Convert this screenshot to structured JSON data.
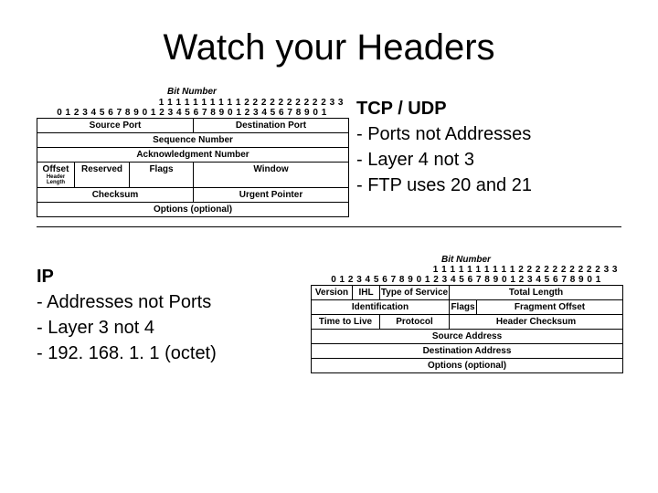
{
  "title": "Watch your Headers",
  "tcp_block": {
    "heading": "TCP / UDP",
    "points": [
      "- Ports not Addresses",
      "- Layer 4 not 3",
      "- FTP uses 20 and 21"
    ]
  },
  "ip_block": {
    "heading": "IP",
    "points": [
      "- Addresses not Ports",
      "- Layer 3 not 4",
      "- 192. 168. 1. 1 (octet)"
    ]
  },
  "bit_header_label": "Bit Number",
  "bit_numbers_row1": "1 1 1 1 1 1 1 1 1 1 2 2 2 2 2 2 2 2 2 2 3 3",
  "bit_numbers_row2": "0 1 2 3 4 5 6 7 8 9 0 1 2 3 4 5 6 7 8 9 0 1 2 3 4 5 6 7 8 9 0 1",
  "tcp_header": {
    "source_port": "Source Port",
    "destination_port": "Destination Port",
    "sequence_number": "Sequence Number",
    "ack_number": "Acknowledgment Number",
    "offset": "Offset",
    "offset_sub": "Header Length",
    "reserved": "Reserved",
    "flags": "Flags",
    "window": "Window",
    "checksum": "Checksum",
    "urgent_pointer": "Urgent Pointer",
    "options": "Options (optional)"
  },
  "ip_header": {
    "version": "Version",
    "ihl": "IHL",
    "tos": "Type of Service",
    "total_length": "Total Length",
    "identification": "Identification",
    "flags": "Flags",
    "fragment_offset": "Fragment Offset",
    "ttl": "Time to Live",
    "protocol": "Protocol",
    "header_checksum": "Header Checksum",
    "source_address": "Source Address",
    "destination_address": "Destination Address",
    "options": "Options (optional)"
  },
  "chart_data": [
    {
      "type": "table",
      "title": "TCP Header Format",
      "bit_width": 32,
      "rows": [
        [
          {
            "field": "Source Port",
            "bits": "0-15"
          },
          {
            "field": "Destination Port",
            "bits": "16-31"
          }
        ],
        [
          {
            "field": "Sequence Number",
            "bits": "0-31"
          }
        ],
        [
          {
            "field": "Acknowledgment Number",
            "bits": "0-31"
          }
        ],
        [
          {
            "field": "Offset (Header Length)",
            "bits": "0-3"
          },
          {
            "field": "Reserved",
            "bits": "4-9"
          },
          {
            "field": "Flags",
            "bits": "10-15"
          },
          {
            "field": "Window",
            "bits": "16-31"
          }
        ],
        [
          {
            "field": "Checksum",
            "bits": "0-15"
          },
          {
            "field": "Urgent Pointer",
            "bits": "16-31"
          }
        ],
        [
          {
            "field": "Options (optional)",
            "bits": "0-31"
          }
        ]
      ]
    },
    {
      "type": "table",
      "title": "IP Header Format",
      "bit_width": 32,
      "rows": [
        [
          {
            "field": "Version",
            "bits": "0-3"
          },
          {
            "field": "IHL",
            "bits": "4-7"
          },
          {
            "field": "Type of Service",
            "bits": "8-15"
          },
          {
            "field": "Total Length",
            "bits": "16-31"
          }
        ],
        [
          {
            "field": "Identification",
            "bits": "0-15"
          },
          {
            "field": "Flags",
            "bits": "16-18"
          },
          {
            "field": "Fragment Offset",
            "bits": "19-31"
          }
        ],
        [
          {
            "field": "Time to Live",
            "bits": "0-7"
          },
          {
            "field": "Protocol",
            "bits": "8-15"
          },
          {
            "field": "Header Checksum",
            "bits": "16-31"
          }
        ],
        [
          {
            "field": "Source Address",
            "bits": "0-31"
          }
        ],
        [
          {
            "field": "Destination Address",
            "bits": "0-31"
          }
        ],
        [
          {
            "field": "Options (optional)",
            "bits": "0-31"
          }
        ]
      ]
    }
  ]
}
